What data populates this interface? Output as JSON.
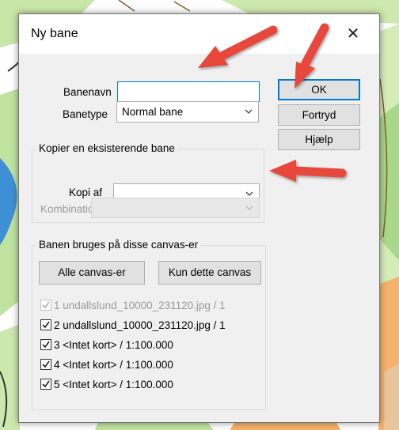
{
  "dialog": {
    "title": "Ny bane",
    "close_glyph": "✕",
    "name_label": "Banenavn",
    "name_value": "",
    "type_label": "Banetype",
    "type_value": "Normal bane",
    "copy_group": "Kopier en eksisterende bane",
    "copy_label": "Kopi af",
    "copy_value": "",
    "combination_label": "Kombination",
    "combination_value": "",
    "ok_label": "OK",
    "cancel_label": "Fortryd",
    "help_label": "Hjælp",
    "canvas_group": "Banen bruges på disse canvas-er",
    "all_canvases_label": "Alle canvas-er",
    "this_canvas_label": "Kun dette canvas",
    "canvases": [
      {
        "label": "1 undallslund_10000_231120.jpg   / 1",
        "checked": true,
        "enabled": false
      },
      {
        "label": "2 undallslund_10000_231120.jpg   / 1",
        "checked": true,
        "enabled": true
      },
      {
        "label": "3 <Intet kort>   / 1:100.000",
        "checked": true,
        "enabled": true
      },
      {
        "label": "4 <Intet kort>   / 1:100.000",
        "checked": true,
        "enabled": true
      },
      {
        "label": "5 <Intet kort>   / 1:100.000",
        "checked": true,
        "enabled": true
      }
    ]
  },
  "colors": {
    "accent": "#0078d7",
    "arrow": "#e8473b",
    "dialog_bg": "#f0f0f0"
  }
}
